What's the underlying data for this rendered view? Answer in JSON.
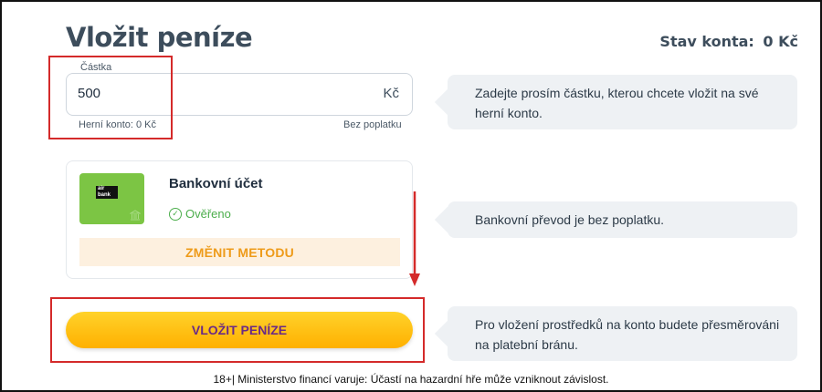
{
  "header": {
    "title": "Vložit peníze",
    "balance_label": "Stav konta:",
    "balance_value": "0 Kč"
  },
  "amount": {
    "label": "Částka",
    "value": "500",
    "currency": "Kč",
    "hint_left": "Herní konto: 0 Kč",
    "hint_right": "Bez poplatku"
  },
  "method": {
    "logo_line1": "air",
    "logo_line2": "bank",
    "name": "Bankovní účet",
    "status": "Ověřeno",
    "change_label": "ZMĚNIT METODU"
  },
  "deposit": {
    "label": "VLOŽIT PENÍZE"
  },
  "info": {
    "amount_text": "Zadejte prosím částku, kterou chcete vložit na své herní konto.",
    "method_text": "Bankovní převod je bez poplatku.",
    "deposit_text": "Pro vložení prostředků na konto budete přesměrováni na platební bránu."
  },
  "footer": {
    "text": "18+| Ministerstvo financí varuje: Účastí na hazardní hře může vzniknout závislost."
  },
  "colors": {
    "highlight": "#d42a2a",
    "accent_orange": "#ee9b1a",
    "button_yellow": "#ffc107",
    "button_text": "#6a2a86",
    "verified_green": "#4cae4c",
    "bank_card_green": "#7cc544"
  }
}
